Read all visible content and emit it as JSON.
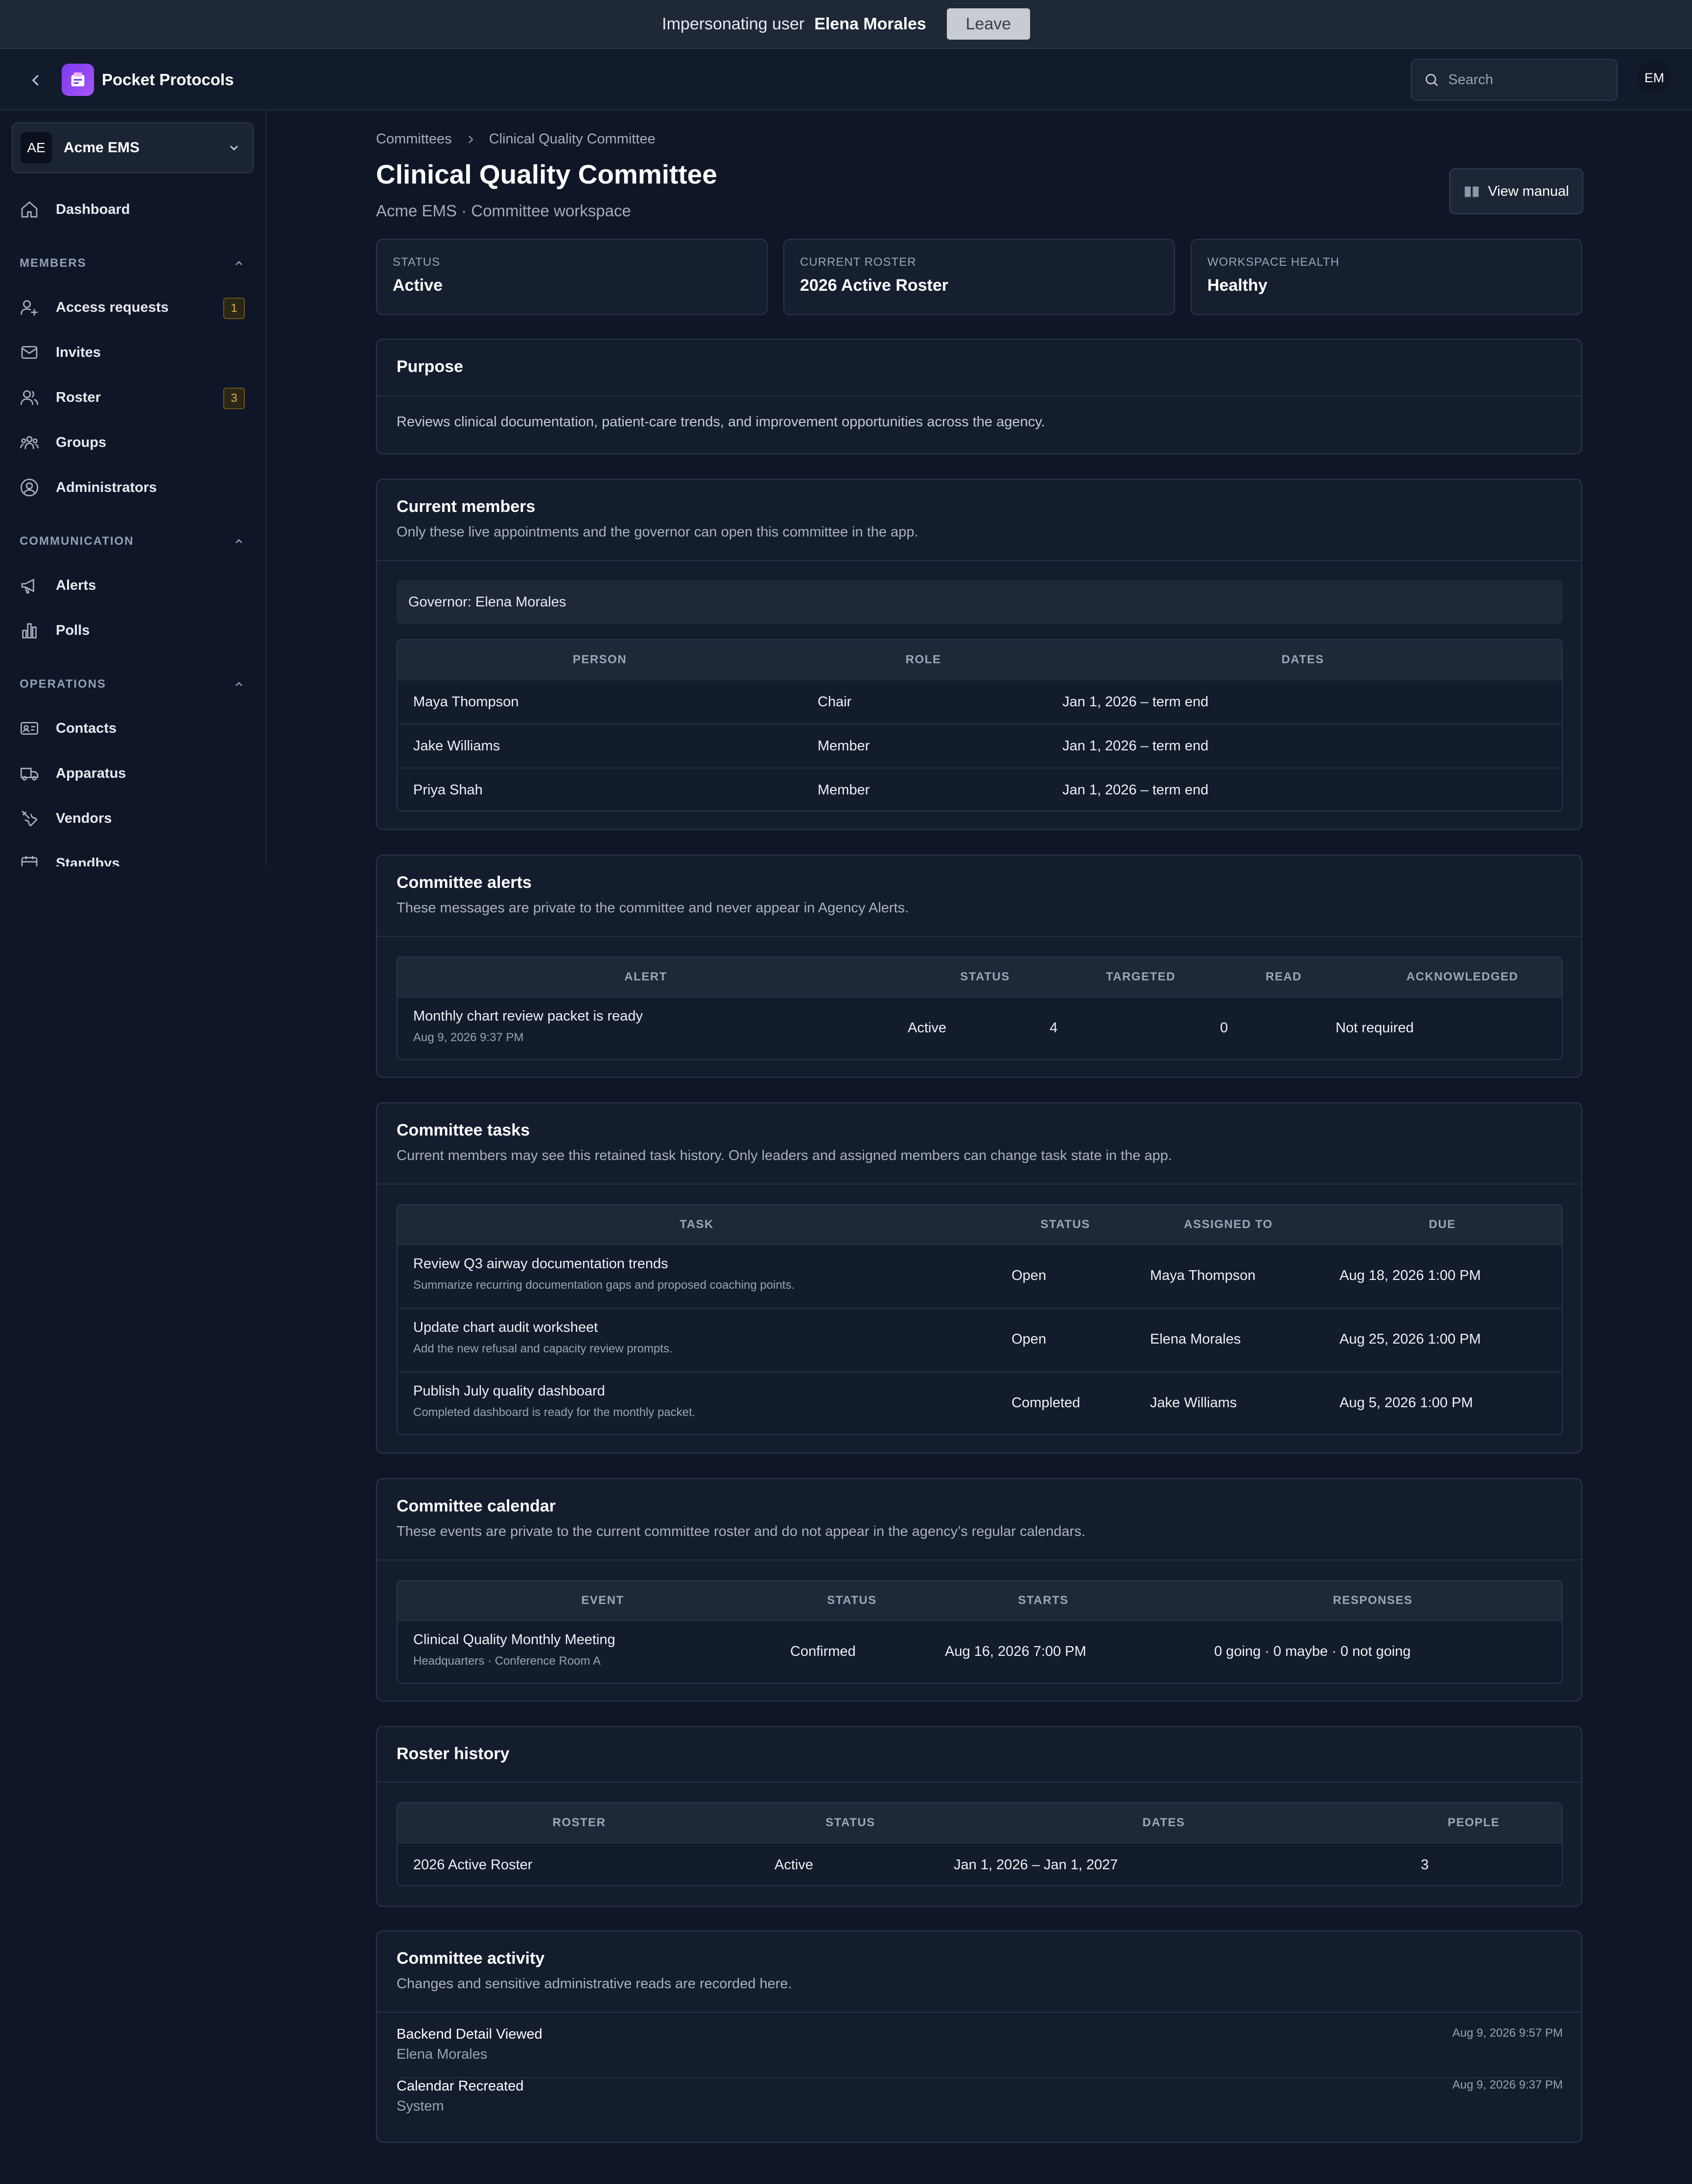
{
  "banner": {
    "prefix": "Impersonating user",
    "user": "Elena Morales",
    "leave": "Leave"
  },
  "app": {
    "title": "Pocket Protocols",
    "search_placeholder": "Search",
    "avatar": "EM"
  },
  "org": {
    "initials": "AE",
    "name": "Acme EMS"
  },
  "sidebar": {
    "dashboard": "Dashboard",
    "members_head": "MEMBERS",
    "access_requests": "Access requests",
    "access_badge": "1",
    "invites": "Invites",
    "roster": "Roster",
    "roster_badge": "3",
    "groups": "Groups",
    "administrators": "Administrators",
    "communication_head": "COMMUNICATION",
    "alerts": "Alerts",
    "polls": "Polls",
    "operations_head": "OPERATIONS",
    "contacts": "Contacts",
    "apparatus": "Apparatus",
    "vendors": "Vendors",
    "standbys": "Standbys"
  },
  "breadcrumb": {
    "root": "Committees",
    "current": "Clinical Quality Committee"
  },
  "page": {
    "title": "Clinical Quality Committee",
    "subtitle": "Acme EMS · Committee workspace",
    "manual": "View manual"
  },
  "stats": [
    {
      "label": "STATUS",
      "value": "Active"
    },
    {
      "label": "CURRENT ROSTER",
      "value": "2026 Active Roster"
    },
    {
      "label": "WORKSPACE HEALTH",
      "value": "Healthy"
    }
  ],
  "purpose": {
    "title": "Purpose",
    "text": "Reviews clinical documentation, patient-care trends, and improvement opportunities across the agency."
  },
  "members": {
    "title": "Current members",
    "desc": "Only these live appointments and the governor can open this committee in the app.",
    "governor": "Governor: Elena Morales",
    "headers": [
      "PERSON",
      "ROLE",
      "DATES"
    ],
    "rows": [
      {
        "person": "Maya Thompson",
        "role": "Chair",
        "dates": "Jan 1, 2026 – term end"
      },
      {
        "person": "Jake Williams",
        "role": "Member",
        "dates": "Jan 1, 2026 – term end"
      },
      {
        "person": "Priya Shah",
        "role": "Member",
        "dates": "Jan 1, 2026 – term end"
      }
    ]
  },
  "alerts": {
    "title": "Committee alerts",
    "desc": "These messages are private to the committee and never appear in Agency Alerts.",
    "headers": [
      "ALERT",
      "STATUS",
      "TARGETED",
      "READ",
      "ACKNOWLEDGED"
    ],
    "rows": [
      {
        "alert": "Monthly chart review packet is ready",
        "time": "Aug 9, 2026 9:37 PM",
        "status": "Active",
        "targeted": "4",
        "read": "0",
        "ack": "Not required"
      }
    ]
  },
  "tasks": {
    "title": "Committee tasks",
    "desc": "Current members may see this retained task history. Only leaders and assigned members can change task state in the app.",
    "headers": [
      "TASK",
      "STATUS",
      "ASSIGNED TO",
      "DUE"
    ],
    "rows": [
      {
        "task": "Review Q3 airway documentation trends",
        "note": "Summarize recurring documentation gaps and proposed coaching points.",
        "status": "Open",
        "assigned": "Maya Thompson",
        "due": "Aug 18, 2026 1:00 PM"
      },
      {
        "task": "Update chart audit worksheet",
        "note": "Add the new refusal and capacity review prompts.",
        "status": "Open",
        "assigned": "Elena Morales",
        "due": "Aug 25, 2026 1:00 PM"
      },
      {
        "task": "Publish July quality dashboard",
        "note": "Completed dashboard is ready for the monthly packet.",
        "status": "Completed",
        "assigned": "Jake Williams",
        "due": "Aug 5, 2026 1:00 PM"
      }
    ]
  },
  "calendar": {
    "title": "Committee calendar",
    "desc": "These events are private to the current committee roster and do not appear in the agency’s regular calendars.",
    "headers": [
      "EVENT",
      "STATUS",
      "STARTS",
      "RESPONSES"
    ],
    "rows": [
      {
        "event": "Clinical Quality Monthly Meeting",
        "location": "Headquarters · Conference Room A",
        "status": "Confirmed",
        "starts": "Aug 16, 2026 7:00 PM",
        "responses": "0 going · 0 maybe · 0 not going"
      }
    ]
  },
  "history": {
    "title": "Roster history",
    "headers": [
      "ROSTER",
      "STATUS",
      "DATES",
      "PEOPLE"
    ],
    "rows": [
      {
        "roster": "2026 Active Roster",
        "status": "Active",
        "dates": "Jan 1, 2026 – Jan 1, 2027",
        "people": "3"
      }
    ]
  },
  "activity": {
    "title": "Committee activity",
    "desc": "Changes and sensitive administrative reads are recorded here.",
    "items": [
      {
        "action": "Backend Detail Viewed",
        "actor": "Elena Morales",
        "time": "Aug 9, 2026 9:57 PM"
      },
      {
        "action": "Calendar Recreated",
        "actor": "System",
        "time": "Aug 9, 2026 9:37 PM"
      }
    ]
  }
}
